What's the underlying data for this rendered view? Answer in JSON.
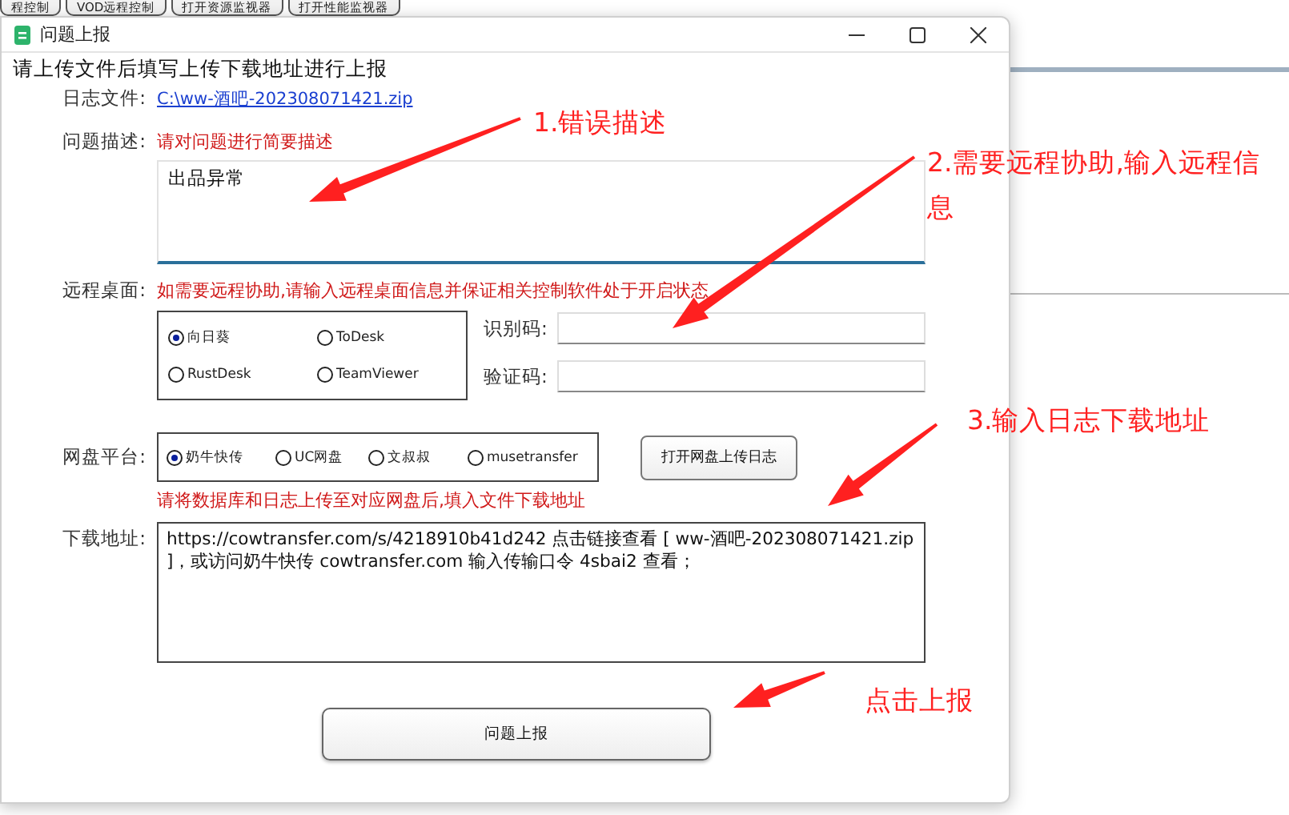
{
  "background_tabs": [
    {
      "label": "程控制"
    },
    {
      "label": "VOD远程控制"
    },
    {
      "label": "打开资源监视器"
    },
    {
      "label": "打开性能监视器"
    }
  ],
  "window": {
    "title": "问题上报"
  },
  "instruction": "请上传文件后填写上传下载地址进行上报",
  "log_file": {
    "label": "日志文件:",
    "path": "C:\\ww-酒吧-202308071421.zip"
  },
  "description": {
    "label": "问题描述:",
    "hint": "请对问题进行简要描述",
    "value": "出品异常"
  },
  "remote_desktop": {
    "label": "远程桌面:",
    "hint": "如需要远程协助,请输入远程桌面信息并保证相关控制软件处于开启状态",
    "options": [
      {
        "label": "向日葵",
        "selected": true
      },
      {
        "label": "ToDesk",
        "selected": false
      },
      {
        "label": "RustDesk",
        "selected": false
      },
      {
        "label": "TeamViewer",
        "selected": false
      }
    ],
    "fields": [
      {
        "label": "识别码:"
      },
      {
        "label": "验证码:"
      }
    ]
  },
  "cloud_disk": {
    "label": "网盘平台:",
    "options": [
      {
        "label": "奶牛快传",
        "selected": true
      },
      {
        "label": "UC网盘",
        "selected": false
      },
      {
        "label": "文叔叔",
        "selected": false
      },
      {
        "label": "musetransfer",
        "selected": false
      }
    ],
    "open_button": "打开网盘上传日志",
    "hint": "请将数据库和日志上传至对应网盘后,填入文件下载地址"
  },
  "download": {
    "label": "下载地址:",
    "value": "https://cowtransfer.com/s/4218910b41d242 点击链接查看 [ ww-酒吧-202308071421.zip ]，或访问奶牛快传 cowtransfer.com 输入传输口令 4sbai2 查看；"
  },
  "submit_button": "问题上报",
  "annotations": [
    {
      "text": "1.错误描述"
    },
    {
      "text": "2.需要远程协助,输入远程信息"
    },
    {
      "text": "3.输入日志下载地址"
    },
    {
      "text": "点击上报"
    }
  ]
}
